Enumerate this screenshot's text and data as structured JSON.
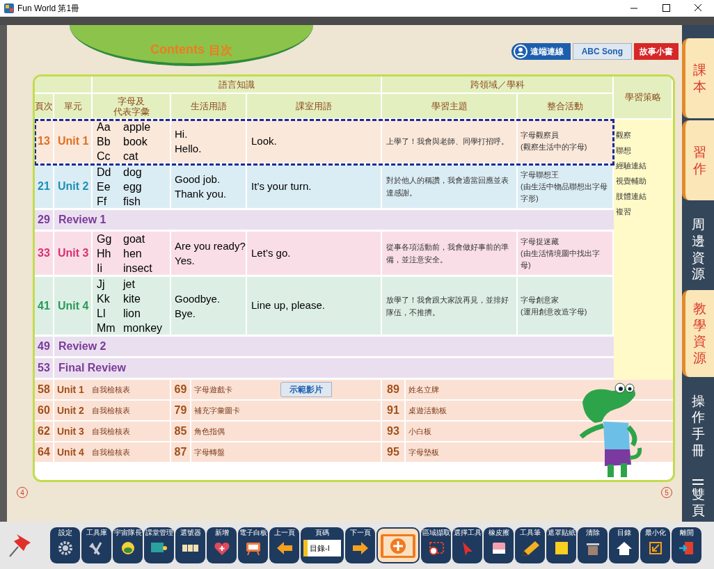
{
  "window": {
    "title": "Fun World 第1冊"
  },
  "banner": {
    "title": "Contents",
    "subtitle": "目次"
  },
  "top_buttons": [
    {
      "label": "遠端連線",
      "kind": "remote"
    },
    {
      "label": "ABC Song",
      "kind": "song"
    },
    {
      "label": "故事小書",
      "kind": "story"
    }
  ],
  "table": {
    "group_headers": [
      "語言知識",
      "跨領域／學科"
    ],
    "strategy_header": "學習策略",
    "columns": [
      [
        "頁次"
      ],
      [
        "單元"
      ],
      [
        "字母及",
        "代表字彙"
      ],
      [
        "生活用語"
      ],
      [
        "課室用語"
      ],
      [
        "學習主題"
      ],
      [
        "整合活動"
      ]
    ],
    "rows": [
      {
        "kind": "unit",
        "page": "13",
        "unit": "Unit 1",
        "color": "#e07020",
        "selected": true,
        "letters": [
          "Aa",
          "Bb",
          "Cc"
        ],
        "words": [
          "apple",
          "book",
          "cat"
        ],
        "daily": [
          "Hi.",
          "Hello."
        ],
        "classroom": "Look.",
        "theme": "上學了！我會與老師、同學打招呼。",
        "activity": "字母觀察員\n(觀察生活中的字母)"
      },
      {
        "kind": "unit",
        "page": "21",
        "unit": "Unit 2",
        "color": "#1f8fb8",
        "selected": false,
        "letters": [
          "Dd",
          "Ee",
          "Ff"
        ],
        "words": [
          "dog",
          "egg",
          "fish"
        ],
        "daily": [
          "Good job.",
          "Thank you."
        ],
        "classroom": "It’s your turn.",
        "theme": "對於他人的稱讚，我會適當回應並表達感謝。",
        "activity": "字母聯想王\n(由生活中物品聯想出字母字形)"
      },
      {
        "kind": "review",
        "page": "29",
        "unit": "Review 1",
        "color": "#7a3a9a",
        "selected": false
      },
      {
        "kind": "unit",
        "page": "33",
        "unit": "Unit 3",
        "color": "#d8306e",
        "selected": false,
        "letters": [
          "Gg",
          "Hh",
          "Ii"
        ],
        "words": [
          "goat",
          "hen",
          "insect"
        ],
        "daily": [
          "Are you ready?",
          "Yes."
        ],
        "classroom": "Let’s go.",
        "theme": "從事各項活動前，我會做好事前的準備，並注意安全。",
        "activity": "字母捉迷藏\n(由生活情境圖中找出字母)"
      },
      {
        "kind": "unit",
        "page": "41",
        "unit": "Unit 4",
        "color": "#2a9a5a",
        "selected": false,
        "letters": [
          "Jj",
          "Kk",
          "Ll",
          "Mm"
        ],
        "words": [
          "jet",
          "kite",
          "lion",
          "monkey"
        ],
        "daily": [
          "Goodbye.",
          "Bye."
        ],
        "classroom": "Line up, please.",
        "theme": "放學了！我會跟大家說再見，並排好隊伍，不推擠。",
        "activity": "字母創意家\n(運用創意改造字母)"
      },
      {
        "kind": "review",
        "page": "49",
        "unit": "Review 2",
        "color": "#7a3a9a",
        "selected": false
      },
      {
        "kind": "review",
        "page": "53",
        "unit": "Final Review",
        "color": "#7a3a9a",
        "selected": false
      }
    ],
    "strategies": [
      "觀察",
      "聯想",
      "經驗連結",
      "視覺輔助",
      "肢體連結",
      "複習"
    ],
    "extra_rows": [
      {
        "page": "58",
        "unit": "Unit 1",
        "item": "自我檢核表",
        "page_2": "69",
        "item_2": "字母遊戲卡",
        "button": "示範影片",
        "page_3": "89",
        "item_3": "姓名立牌"
      },
      {
        "page": "60",
        "unit": "Unit 2",
        "item": "自我檢核表",
        "page_2": "79",
        "item_2": "補充字彙圖卡",
        "page_3": "91",
        "item_3": "桌遊活動板"
      },
      {
        "page": "62",
        "unit": "Unit 3",
        "item": "自我檢核表",
        "page_2": "85",
        "item_2": "角色指偶",
        "page_3": "93",
        "item_3": "小白板"
      },
      {
        "page": "64",
        "unit": "Unit 4",
        "item": "自我檢核表",
        "page_2": "87",
        "item_2": "字母轉盤",
        "page_3": "95",
        "item_3": "字母墊板"
      }
    ]
  },
  "page_numbers": [
    "4",
    "5"
  ],
  "side_tabs": [
    {
      "label": "課本",
      "kind": "folder"
    },
    {
      "label": "習作",
      "kind": "folder"
    },
    {
      "label": "周邊資源",
      "kind": "strip"
    },
    {
      "label": "教學資源",
      "kind": "folder"
    },
    {
      "label": "操作手冊",
      "kind": "strip"
    },
    {
      "label": "雙頁",
      "kind": "pages"
    }
  ],
  "toolbar": [
    {
      "kind": "tool",
      "label": "設定"
    },
    {
      "kind": "tool",
      "label": "工具庫"
    },
    {
      "kind": "tool",
      "label": "宇宙隊長"
    },
    {
      "kind": "tool",
      "label": "課堂管理"
    },
    {
      "kind": "tool",
      "label": "選號器"
    },
    {
      "kind": "tool",
      "label": "新增"
    },
    {
      "kind": "tool",
      "label": "電子白板"
    },
    {
      "kind": "tool",
      "label": "上一頁"
    },
    {
      "kind": "page",
      "label": "頁碼",
      "value": "目錄-I"
    },
    {
      "kind": "tool",
      "label": "下一頁"
    },
    {
      "kind": "main"
    },
    {
      "kind": "tool",
      "label": "區域擷取"
    },
    {
      "kind": "tool",
      "label": "選擇工具"
    },
    {
      "kind": "tool",
      "label": "橡皮擦"
    },
    {
      "kind": "tool",
      "label": "工具筆"
    },
    {
      "kind": "tool",
      "label": "遮罩貼紙"
    },
    {
      "kind": "tool",
      "label": "清除"
    },
    {
      "kind": "tool",
      "label": "目錄"
    },
    {
      "kind": "tool",
      "label": "最小化"
    },
    {
      "kind": "tool",
      "label": "離開"
    }
  ]
}
